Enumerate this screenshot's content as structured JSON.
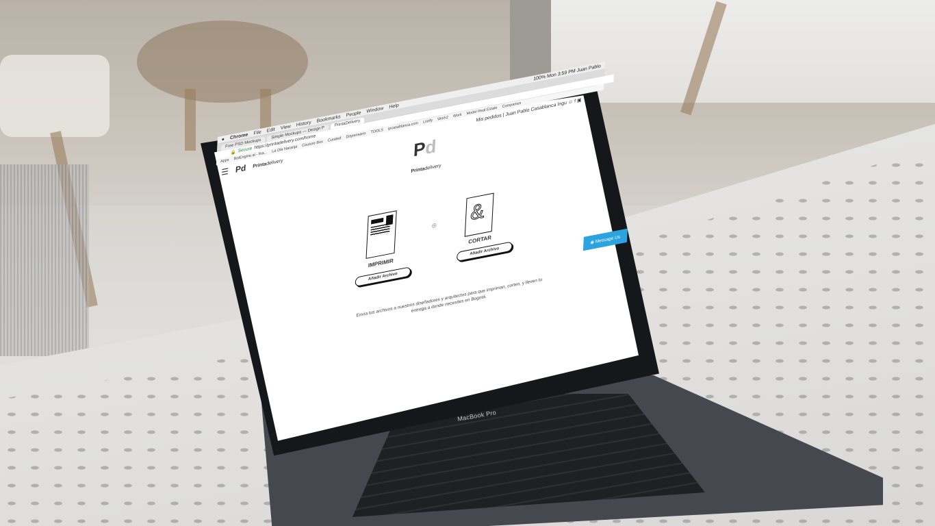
{
  "macos_menu": {
    "items": [
      "Chrome",
      "File",
      "Edit",
      "View",
      "History",
      "Bookmarks",
      "People",
      "Window",
      "Help"
    ],
    "clock": "Mon 3:59 PM",
    "battery": "100%",
    "user": "Juan Pablo"
  },
  "browser": {
    "tabs": [
      {
        "label": "Free PSD Mockups",
        "active": false
      },
      {
        "label": "Simple Mockups — Design P",
        "active": false
      },
      {
        "label": "PrintaDelivery",
        "active": true
      }
    ],
    "url_secure_label": "Secure",
    "url": "https://printadelivery.com/home",
    "bookmarks": [
      "Apps",
      "BotEngine.ai - Itra...",
      "La Ola Naranja",
      "Couture Box",
      "Curated",
      "Dispensario",
      "TOOLS",
      "ipcasablanca.com",
      "Listify",
      "Work2",
      "Work",
      "Model Real Estate",
      "Companies"
    ]
  },
  "site": {
    "logo_mark": "Pd",
    "logo_text_bold": "Printa",
    "logo_text_light": "delivery",
    "nav_orders": "Mis pedidos",
    "nav_user": "Juan Pablo Casablanca Ingu",
    "center_logo_p": "P",
    "center_logo_d": "d",
    "print_label": "IMPRIMIR",
    "print_button": "Añadir Archivo",
    "cut_label": "CORTAR",
    "cut_button": "Añadir Archivo",
    "description": "Envía tus archivos a nuestros diseñadores y arquitectos para que impriman, corten, y lleven tu entrega a donde necesites en Bogotá.",
    "message_button": "Message Us"
  },
  "device": {
    "brand": "MacBook Pro"
  }
}
